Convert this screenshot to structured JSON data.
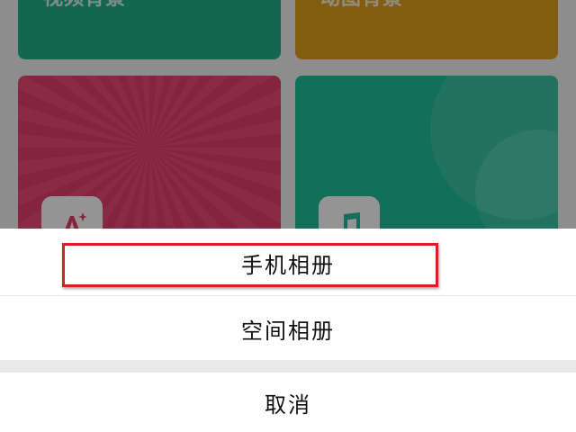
{
  "background_cards": [
    {
      "label": "视频背景",
      "color": "#1fb488"
    },
    {
      "label": "动图背景",
      "color": "#e0a01c"
    },
    {
      "label": "",
      "color": "#e53e6c",
      "icon": "text-style-icon"
    },
    {
      "label": "",
      "color": "#1fbf9a",
      "icon": "music-note-icon"
    }
  ],
  "action_sheet": {
    "option_phone_album": "手机相册",
    "option_space_album": "空间相册",
    "cancel": "取消"
  },
  "highlight": {
    "color": "#d91f1f",
    "target": "option_phone_album"
  },
  "overlay_color": "rgba(0,0,0,0.42)"
}
